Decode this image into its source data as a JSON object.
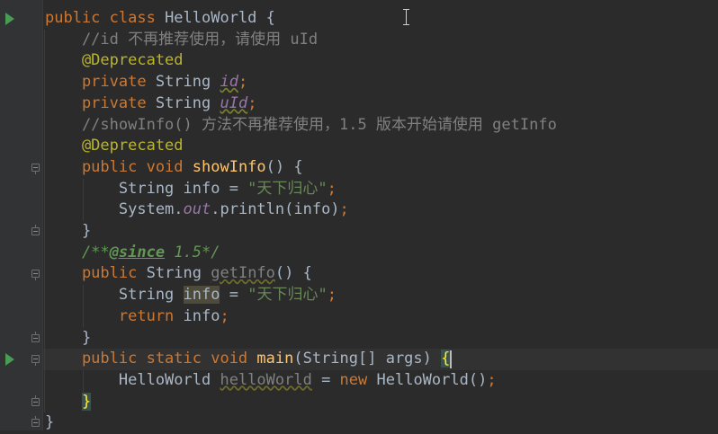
{
  "editor": {
    "lines": [
      [
        {
          "t": "public class ",
          "c": "kw"
        },
        {
          "t": "HelloWorld {",
          "c": "plain"
        }
      ],
      [
        {
          "t": "    //id 不再推荐使用，请使用 uId",
          "c": "com"
        }
      ],
      [
        {
          "t": "    @Deprecated",
          "c": "ann"
        }
      ],
      [
        {
          "t": "    private ",
          "c": "kw"
        },
        {
          "t": "String ",
          "c": "plain"
        },
        {
          "t": "id",
          "c": "field-warn"
        },
        {
          "t": ";",
          "c": "kw"
        }
      ],
      [
        {
          "t": "    private ",
          "c": "kw"
        },
        {
          "t": "String ",
          "c": "plain"
        },
        {
          "t": "uId",
          "c": "field-warn"
        },
        {
          "t": ";",
          "c": "kw"
        }
      ],
      [
        {
          "t": "    //showInfo() 方法不再推荐使用，1.5 版本开始请使用 getInfo",
          "c": "com"
        }
      ],
      [
        {
          "t": "    @Deprecated",
          "c": "ann"
        }
      ],
      [
        {
          "t": "    public void ",
          "c": "kw"
        },
        {
          "t": "showInfo",
          "c": "fn"
        },
        {
          "t": "() {",
          "c": "plain"
        }
      ],
      [
        {
          "t": "        String info = ",
          "c": "plain"
        },
        {
          "t": "\"天下归心\"",
          "c": "str"
        },
        {
          "t": ";",
          "c": "kw"
        }
      ],
      [
        {
          "t": "        System.",
          "c": "plain"
        },
        {
          "t": "out",
          "c": "field"
        },
        {
          "t": ".println(info)",
          "c": "plain"
        },
        {
          "t": ";",
          "c": "kw"
        }
      ],
      [
        {
          "t": "    }",
          "c": "plain"
        }
      ],
      [
        {
          "t": "    /**",
          "c": "doc"
        },
        {
          "t": "@since",
          "c": "doc-tag"
        },
        {
          "t": " 1.5*/",
          "c": "doc"
        }
      ],
      [
        {
          "t": "    public ",
          "c": "kw"
        },
        {
          "t": "String ",
          "c": "plain"
        },
        {
          "t": "getInfo",
          "c": "unused"
        },
        {
          "t": "() {",
          "c": "plain"
        }
      ],
      [
        {
          "t": "        String ",
          "c": "plain"
        },
        {
          "t": "info",
          "c": "hl"
        },
        {
          "t": " = ",
          "c": "plain"
        },
        {
          "t": "\"天下归心\"",
          "c": "str"
        },
        {
          "t": ";",
          "c": "kw"
        }
      ],
      [
        {
          "t": "        return ",
          "c": "kw"
        },
        {
          "t": "info",
          "c": "plain"
        },
        {
          "t": ";",
          "c": "kw"
        }
      ],
      [
        {
          "t": "    }",
          "c": "plain"
        }
      ],
      [
        {
          "t": "    public static void ",
          "c": "kw"
        },
        {
          "t": "main",
          "c": "fn"
        },
        {
          "t": "(String[] args) ",
          "c": "plain"
        },
        {
          "t": "{",
          "c": "brace-hl"
        }
      ],
      [
        {
          "t": "        HelloWorld ",
          "c": "plain"
        },
        {
          "t": "helloWorld",
          "c": "unused"
        },
        {
          "t": " = ",
          "c": "plain"
        },
        {
          "t": "new ",
          "c": "kw"
        },
        {
          "t": "HelloWorld()",
          "c": "plain"
        },
        {
          "t": ";",
          "c": "kw"
        }
      ],
      [
        {
          "t": "    ",
          "c": "plain"
        },
        {
          "t": "}",
          "c": "brace-hl"
        }
      ],
      [
        {
          "t": "}",
          "c": "plain"
        }
      ]
    ],
    "current_line": 16,
    "gutter": {
      "run_lines": [
        0,
        16
      ],
      "fold_start_lines": [
        7,
        12,
        16
      ],
      "fold_end_lines": [
        10,
        15,
        18,
        19
      ]
    }
  }
}
